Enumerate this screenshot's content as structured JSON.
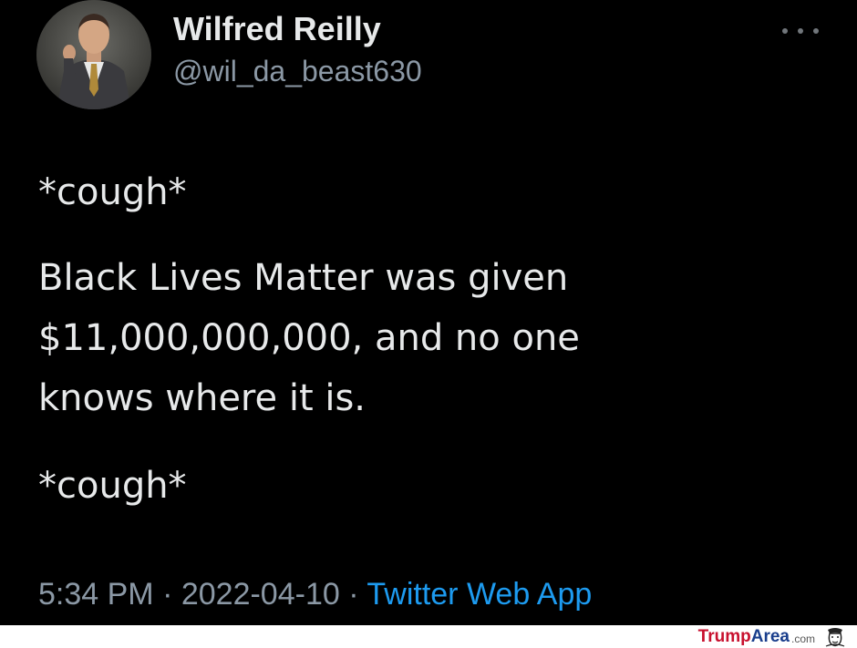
{
  "tweet": {
    "author": {
      "display_name": "Wilfred Reilly",
      "handle": "@wil_da_beast630",
      "avatar_icon": "profile-photo-man-in-suit"
    },
    "more_icon": "ellipsis-icon",
    "body": {
      "para1": "*cough*",
      "para2": "Black Lives Matter was given\n$11,000,000,000, and no one\nknows where it is.",
      "para3": "*cough*"
    },
    "meta": {
      "time": "5:34 PM",
      "separator": " · ",
      "date": "2022-04-10",
      "app": "Twitter Web App"
    }
  },
  "watermark": {
    "part1": "Trump",
    "part2": "Area",
    "part3": ".com"
  },
  "colors": {
    "background": "#000000",
    "text": "#e7e9ea",
    "secondary": "#8b98a5",
    "link": "#1d9bf0"
  }
}
